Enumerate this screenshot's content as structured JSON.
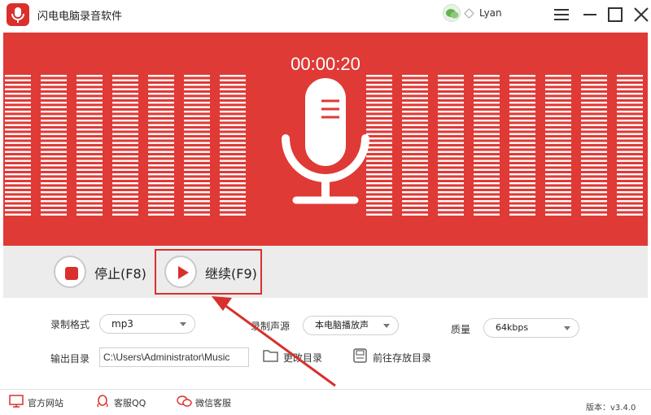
{
  "titlebar": {
    "app_title": "闪电电脑录音软件",
    "user_name": "Lyan",
    "buttons": [
      "menu-icon",
      "minimize-icon",
      "maximize-icon",
      "close-icon"
    ]
  },
  "recorder": {
    "timer": "00:00:20",
    "accent_color": "#df3a36",
    "stop_label": "停止(F8)",
    "continue_label": "继续(F9)"
  },
  "settings": {
    "format_label": "录制格式",
    "format_value": "mp3",
    "source_label": "录制声源",
    "source_value": "本电脑播放声",
    "quality_label": "质量",
    "quality_value": "64kbps",
    "output_label": "输出目录",
    "output_path": "C:\\Users\\Administrator\\Music",
    "change_dir_label": "更改目录",
    "open_dir_label": "前往存放目录"
  },
  "footer": {
    "website_label": "官方网站",
    "qq_label": "客服QQ",
    "wechat_label": "微信客服",
    "version": "版本：v3.4.0"
  }
}
